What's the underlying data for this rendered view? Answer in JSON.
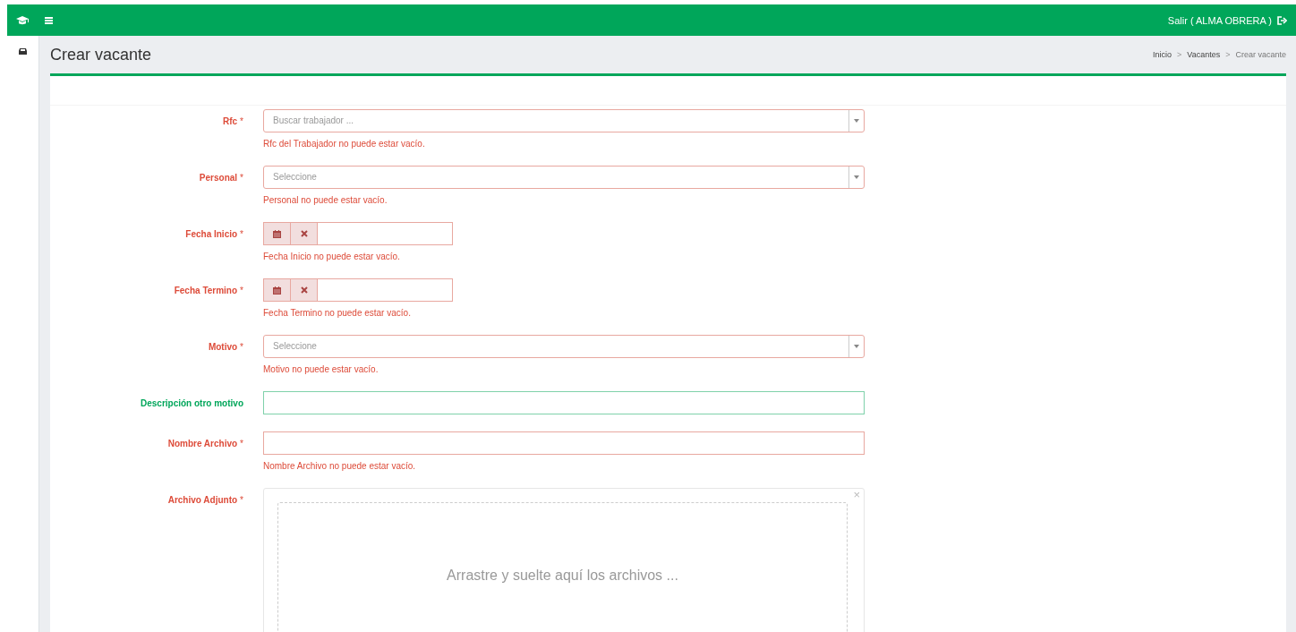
{
  "topbar": {
    "user_link": "Salir ( ALMA OBRERA )"
  },
  "page": {
    "title": "Crear vacante",
    "breadcrumb": [
      {
        "label": "Inicio",
        "current": false
      },
      {
        "separator": ">",
        "label": "Vacantes",
        "current": false
      },
      {
        "separator": ">",
        "label": "Crear vacante",
        "current": true
      }
    ]
  },
  "form": {
    "fields": [
      {
        "kind": "select",
        "label": "Rfc",
        "required_mark": "*",
        "has_error": true,
        "placeholder": "Buscar trabajador ...",
        "error": "Rfc del Trabajador no puede estar vacío."
      },
      {
        "kind": "select",
        "label": "Personal",
        "required_mark": "*",
        "has_error": true,
        "placeholder": "Seleccione",
        "error": "Personal no puede estar vacío."
      },
      {
        "kind": "date",
        "label": "Fecha Inicio",
        "required_mark": "*",
        "has_error": true,
        "error": "Fecha Inicio no puede estar vacío."
      },
      {
        "kind": "date",
        "label": "Fecha Termino",
        "required_mark": "*",
        "has_error": true,
        "error": "Fecha Termino no puede estar vacío."
      },
      {
        "kind": "select",
        "label": "Motivo",
        "required_mark": "*",
        "has_error": true,
        "placeholder": "Seleccione",
        "error": "Motivo no puede estar vacío."
      },
      {
        "kind": "text",
        "label": "Descripción otro motivo",
        "has_error": false,
        "valid": true
      },
      {
        "kind": "text",
        "label": "Nombre Archivo",
        "required_mark": "*",
        "has_error": true,
        "error": "Nombre Archivo no puede estar vacío."
      },
      {
        "kind": "file",
        "label": "Archivo Adjunto",
        "required_mark": "*",
        "has_error": true,
        "close_mark": "×",
        "dropzone_text": "Arrastre y suelte aquí los archivos ..."
      }
    ]
  }
}
